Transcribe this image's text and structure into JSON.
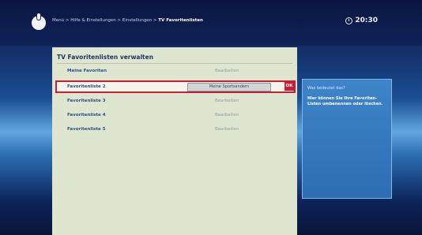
{
  "header": {
    "breadcrumbs": "Menü > Hilfe & Einstellungen > Einstellungen >",
    "current_page": "TV Favoritenlisten",
    "time": "20:30"
  },
  "panel": {
    "title": "TV Favoritenlisten verwalten",
    "rows": [
      {
        "name": "Meine Favoriten",
        "value": "Bearbeiten"
      },
      {
        "name": "Favoritenliste 2",
        "value": "Meine Sportsendern"
      },
      {
        "name": "Favoritenliste 3",
        "value": "Bearbeiten"
      },
      {
        "name": "Favoritenliste 4",
        "value": "Bearbeiten"
      },
      {
        "name": "Favoritenliste 5",
        "value": "Bearbeiten"
      }
    ],
    "ok_label": "OK"
  },
  "help": {
    "title": "Was bedeutet das?",
    "text": "Hier können Sie Ihre Favoriten-Listen umbenennen oder löschen."
  }
}
